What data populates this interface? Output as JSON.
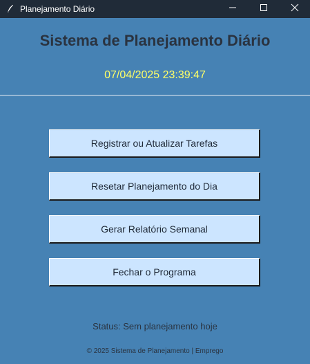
{
  "window": {
    "title": "Planejamento Diário",
    "icon": "feather-icon",
    "controls": [
      "minimize-icon",
      "maximize-icon",
      "close-icon"
    ]
  },
  "header": {
    "title": "Sistema de Planejamento Diário",
    "datetime": "07/04/2025 23:39:47"
  },
  "actions": {
    "register_label": "Registrar ou Atualizar Tarefas",
    "reset_label": "Resetar Planejamento do Dia",
    "report_label": "Gerar Relatório Semanal",
    "close_label": "Fechar o Programa"
  },
  "status": "Status: Sem planejamento hoje",
  "footer": "© 2025 Sistema de Planejamento | Emprego",
  "colors": {
    "background": "#4682b4",
    "titlebar": "#202b38",
    "button": "#cce5ff",
    "datetime": "#ffff66",
    "heading": "#2a3340"
  }
}
